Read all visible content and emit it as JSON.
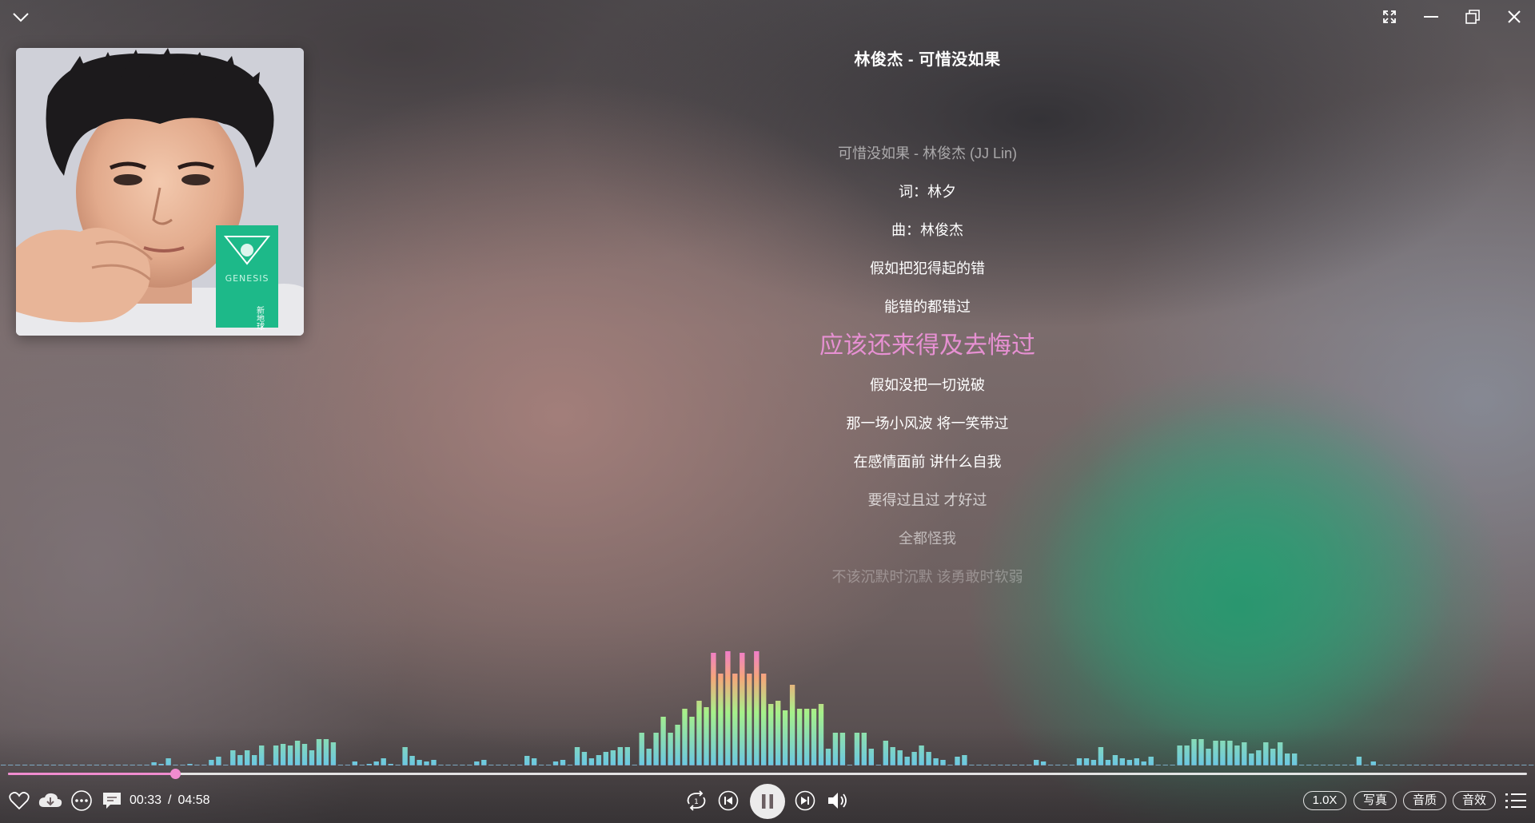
{
  "window": {
    "collapse_icon": "chevron-down-icon",
    "controls": [
      "fullscreen-icon",
      "minimize-icon",
      "restore-icon",
      "close-icon"
    ]
  },
  "song": {
    "title": "林俊杰 - 可惜没如果"
  },
  "album_cover": {
    "text_lines": [
      "GENESIS",
      "新地球"
    ]
  },
  "lyrics": [
    {
      "text": "可惜没如果 - 林俊杰 (JJ Lin)",
      "state": "dim1"
    },
    {
      "text": "词：林夕",
      "state": "normal"
    },
    {
      "text": "曲：林俊杰",
      "state": "normal"
    },
    {
      "text": "假如把犯得起的错",
      "state": "normal"
    },
    {
      "text": "能错的都错过",
      "state": "normal"
    },
    {
      "text": "应该还来得及去悔过",
      "state": "active"
    },
    {
      "text": "假如没把一切说破",
      "state": "normal"
    },
    {
      "text": "那一场小风波 将一笑带过",
      "state": "normal"
    },
    {
      "text": "在感情面前 讲什么自我",
      "state": "normal"
    },
    {
      "text": "要得过且过 才好过",
      "state": "soft"
    },
    {
      "text": "全都怪我",
      "state": "dim1"
    },
    {
      "text": "不该沉默时沉默 该勇敢时软弱",
      "state": "dim0"
    }
  ],
  "playback": {
    "current_time": "00:33",
    "separator": "/",
    "total_time": "04:58",
    "progress": 0.11,
    "state": "playing"
  },
  "controls_left": [
    "heart-icon",
    "download-icon",
    "more-icon",
    "comment-icon"
  ],
  "controls_center": [
    "repeat-one-icon",
    "previous-icon",
    "pause-icon",
    "next-icon",
    "volume-icon"
  ],
  "pills": {
    "speed": "1.0X",
    "photo": "写真",
    "quality": "音质",
    "effect": "音效"
  },
  "playlist_icon": "playlist-icon",
  "spectrum_levels": [
    0,
    0,
    0,
    0,
    0,
    0,
    0,
    0,
    0,
    0,
    0,
    0,
    0,
    0,
    0,
    0,
    0,
    0,
    0,
    0,
    0,
    3,
    1,
    8,
    0,
    0,
    1,
    0,
    0,
    6,
    10,
    0,
    18,
    12,
    18,
    12,
    24,
    0,
    24,
    26,
    24,
    30,
    26,
    18,
    32,
    32,
    28,
    0,
    0,
    4,
    0,
    1,
    4,
    8,
    1,
    0,
    22,
    11,
    6,
    4,
    6,
    0,
    0,
    0,
    0,
    0,
    4,
    6,
    0,
    0,
    0,
    0,
    0,
    11,
    8,
    0,
    0,
    4,
    6,
    0,
    22,
    16,
    8,
    12,
    16,
    18,
    22,
    22,
    0,
    40,
    20,
    40,
    60,
    40,
    50,
    70,
    60,
    80,
    72,
    140,
    114,
    142,
    114,
    140,
    114,
    142,
    114,
    76,
    80,
    68,
    100,
    70,
    70,
    70,
    76,
    20,
    40,
    40,
    0,
    40,
    40,
    20,
    0,
    30,
    22,
    18,
    10,
    16,
    24,
    16,
    8,
    6,
    0,
    10,
    12,
    0,
    0,
    0,
    0,
    0,
    0,
    0,
    0,
    0,
    6,
    4,
    0,
    0,
    0,
    0,
    8,
    8,
    6,
    22,
    6,
    12,
    8,
    6,
    8,
    4,
    10,
    0,
    0,
    0,
    24,
    24,
    32,
    32,
    20,
    30,
    30,
    30,
    24,
    28,
    14,
    18,
    28,
    20,
    28,
    14,
    14,
    0,
    0,
    0,
    0,
    0,
    0,
    0,
    0,
    10,
    0,
    4,
    0,
    0,
    0,
    0,
    0,
    0,
    0,
    0,
    0,
    0,
    0,
    0,
    0,
    0,
    0,
    0,
    0,
    0,
    0,
    0,
    0,
    0
  ],
  "colors": {
    "accent": "#f08ccf",
    "lyric_active": "#e690d2",
    "spectrum_low": "#6cc8e0",
    "spectrum_mid": "#a6f08a",
    "spectrum_high": "#f07ad0",
    "cover_green": "#1db989"
  }
}
